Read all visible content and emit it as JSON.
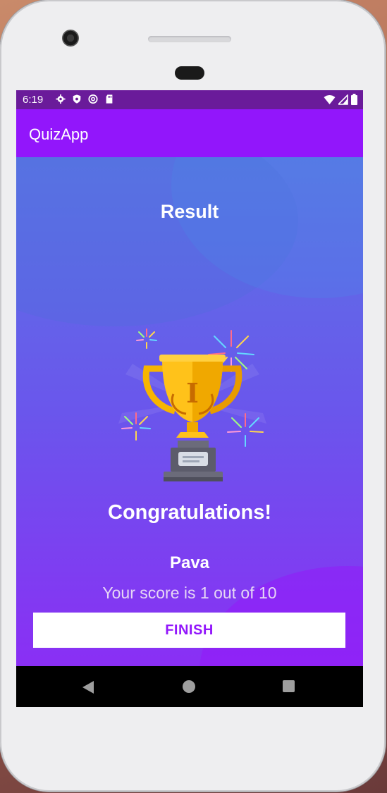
{
  "status_bar": {
    "time": "6:19",
    "left_icons": [
      "settings-icon",
      "shield-icon",
      "at-sign-icon",
      "sd-card-icon"
    ],
    "right_icons": [
      "wifi-icon",
      "signal-icon",
      "battery-icon"
    ]
  },
  "app_bar": {
    "title": "QuizApp"
  },
  "result": {
    "title": "Result",
    "image": "trophy-icon",
    "congrats": "Congratulations!",
    "username": "Pava",
    "score_text": "Your score is 1 out of 10",
    "finish_label": "FINISH"
  },
  "nav_bar": {
    "buttons": [
      "back-icon",
      "home-icon",
      "recents-icon"
    ]
  },
  "colors": {
    "status_bar": "#6a1b9a",
    "app_bar": "#9216fb",
    "accent": "#9216fb",
    "gradient_top": "#5a76e4",
    "gradient_bottom": "#8a2ff4"
  }
}
